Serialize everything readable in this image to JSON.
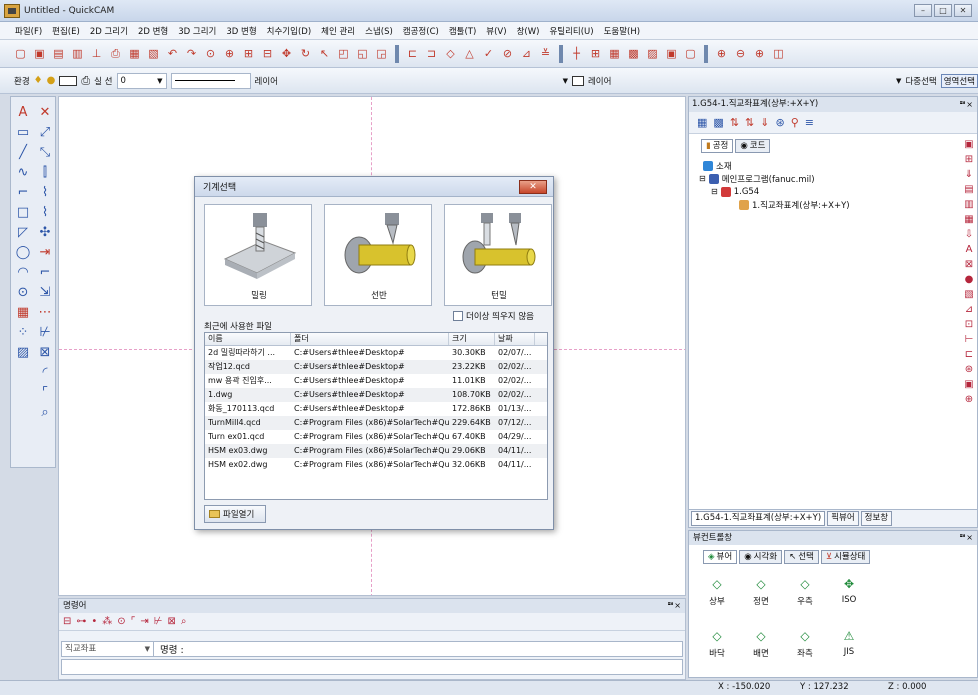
{
  "window": {
    "title": "Untitled - QuickCAM",
    "controls": [
      "–",
      "□",
      "✕"
    ]
  },
  "menu": [
    "파일(F)",
    "편집(E)",
    "2D 그리기",
    "2D 변형",
    "3D 그리기",
    "3D 변형",
    "치수기입(D)",
    "체인 관리",
    "스냅(S)",
    "캠공정(C)",
    "캠툴(T)",
    "뷰(V)",
    "창(W)",
    "유틸리티(U)",
    "도움말(H)"
  ],
  "toolbar2": {
    "env_label": "환경",
    "line_type_label": "실 선",
    "value": "0",
    "layer1": "레이어",
    "layer2": "레이어",
    "multi_select": "다중선택",
    "area_select": "영역선택"
  },
  "dialog": {
    "title": "기계선택",
    "close": "✕",
    "machines": [
      "밀링",
      "선반",
      "턴밀"
    ],
    "dont_show_again": "더이상 띄우지 않음",
    "recent_files_label": "최근에 사용한 파일",
    "columns": [
      "이름",
      "폴더",
      "크기",
      "날짜"
    ],
    "files": [
      {
        "name": "2d 밀링따라하기 ...",
        "folder": "C:#Users#thlee#Desktop#",
        "size": "30.30KB",
        "date": "02/07/..."
      },
      {
        "name": "작업12.qcd",
        "folder": "C:#Users#thlee#Desktop#",
        "size": "23.22KB",
        "date": "02/02/..."
      },
      {
        "name": "mw 용곽 진입후...",
        "folder": "C:#Users#thlee#Desktop#",
        "size": "11.01KB",
        "date": "02/02/..."
      },
      {
        "name": "1.dwg",
        "folder": "C:#Users#thlee#Desktop#",
        "size": "108.70KB",
        "date": "02/02/..."
      },
      {
        "name": "화동_170113.qcd",
        "folder": "C:#Users#thlee#Desktop#",
        "size": "172.86KB",
        "date": "01/13/..."
      },
      {
        "name": "TurnMill4.qcd",
        "folder": "C:#Program Files (x86)#SolarTech#Qu...",
        "size": "229.64KB",
        "date": "07/12/..."
      },
      {
        "name": "Turn ex01.qcd",
        "folder": "C:#Program Files (x86)#SolarTech#Qu...",
        "size": "67.40KB",
        "date": "04/29/..."
      },
      {
        "name": "HSM ex03.dwg",
        "folder": "C:#Program Files (x86)#SolarTech#Qu...",
        "size": "29.06KB",
        "date": "04/11/..."
      },
      {
        "name": "HSM ex02.dwg",
        "folder": "C:#Program Files (x86)#SolarTech#Qu...",
        "size": "32.06KB",
        "date": "04/11/..."
      }
    ],
    "open_file": "파일열기"
  },
  "tree_panel": {
    "title": "1.G54-1.직교좌표계(상부:+X+Y)",
    "pin": "ᅖ×",
    "tabs": [
      "공정",
      "코드"
    ],
    "nodes": [
      "소재",
      "메인프로그램(fanuc.mil)",
      "1.G54",
      "1.직교좌표계(상부:+X+Y)"
    ],
    "bottom_tabs": [
      "1.G54-1.직교좌표계(상부:+X+Y)",
      "픽뷰어",
      "정보창"
    ]
  },
  "view_panel": {
    "title": "뷰컨트롤창",
    "pin": "ᅖ×",
    "tabs": [
      "뷰어",
      "시각화",
      "선택",
      "시뮬상태"
    ],
    "views": [
      "상부",
      "정면",
      "우측",
      "ISO",
      "바닥",
      "배면",
      "좌측",
      "JIS"
    ]
  },
  "command_panel": {
    "title": "명령어",
    "close": "ᅖ×",
    "coord_select": "직교좌표",
    "prompt": "명령 :"
  },
  "status": {
    "x": "X : -150.020",
    "y": "Y : 127.232",
    "z": "Z : 0.000"
  }
}
